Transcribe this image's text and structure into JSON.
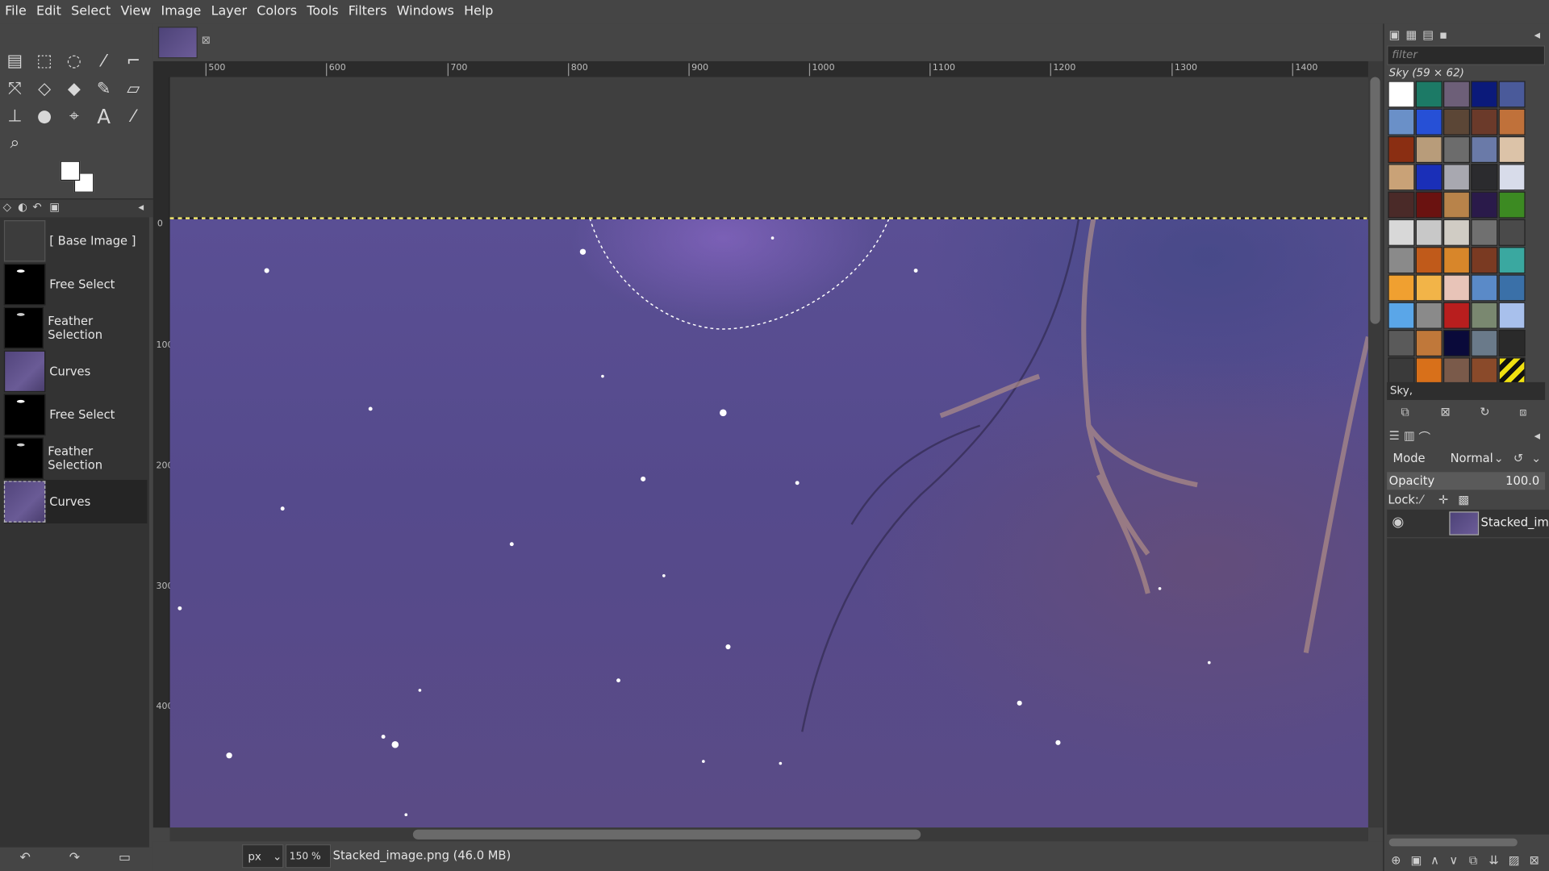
{
  "menubar": {
    "items": [
      "File",
      "Edit",
      "Select",
      "View",
      "Image",
      "Layer",
      "Colors",
      "Tools",
      "Filters",
      "Windows",
      "Help"
    ]
  },
  "toolbox": {
    "tools": [
      "align-tool-icon",
      "rect-select-icon",
      "lasso-icon",
      "fuzzy-select-icon",
      "crop-icon",
      "transform-icon",
      "warp-icon",
      "bucket-fill-icon",
      "paintbrush-icon",
      "eraser-icon",
      "clone-icon",
      "smudge-icon",
      "paths-icon",
      "text-icon",
      "color-picker-icon",
      "zoom-icon"
    ]
  },
  "history": {
    "items": [
      {
        "label": "[ Base Image ]"
      },
      {
        "label": "Free Select"
      },
      {
        "label": "Feather Selection"
      },
      {
        "label": "Curves"
      },
      {
        "label": "Free Select"
      },
      {
        "label": "Feather Selection"
      },
      {
        "label": "Curves"
      }
    ]
  },
  "ruler": {
    "top": [
      "500",
      "600",
      "700",
      "800",
      "900",
      "1000",
      "1100",
      "1200",
      "1300",
      "1400"
    ],
    "left": [
      "0",
      "100",
      "200",
      "300",
      "400"
    ]
  },
  "status": {
    "unit": "px",
    "zoom": "150 %",
    "file": "Stacked_image.png (46.0 MB)"
  },
  "patterns": {
    "filter_placeholder": "filter",
    "title": "Sky (59 × 62)",
    "selected_name": "Sky,"
  },
  "layers": {
    "mode_label": "Mode",
    "mode_value": "Normal",
    "opacity_label": "Opacity",
    "opacity_value": "100.0",
    "lock_label": "Lock:",
    "items": [
      {
        "name": "Stacked_image"
      }
    ]
  }
}
